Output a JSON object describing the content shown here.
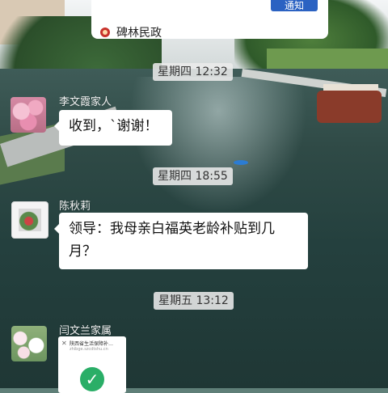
{
  "top_card": {
    "button_label": "通知",
    "source_name": "碑林民政",
    "source_icon": "emblem-icon"
  },
  "timestamps": [
    "星期四 12:32",
    "星期四 18:55",
    "星期五 13:12"
  ],
  "messages": [
    {
      "sender": "李文霞家人",
      "text": "收到，`谢谢！",
      "avatar": "blossom-avatar"
    },
    {
      "sender": "陈秋莉",
      "text": "领导：我母亲白福英老龄补贴到几月？",
      "avatar": "flower-pot-avatar"
    },
    {
      "sender": "闫文兰家属",
      "avatar": "white-flower-avatar",
      "card": {
        "title": "陕西省生活保障补…",
        "url": "zhibge.szcdtshu.cn",
        "close_icon": "close-icon",
        "status_icon": "check-icon"
      }
    }
  ],
  "colors": {
    "accent": "#2b62c2",
    "bubble": "#ffffff",
    "success": "#2aae67"
  }
}
